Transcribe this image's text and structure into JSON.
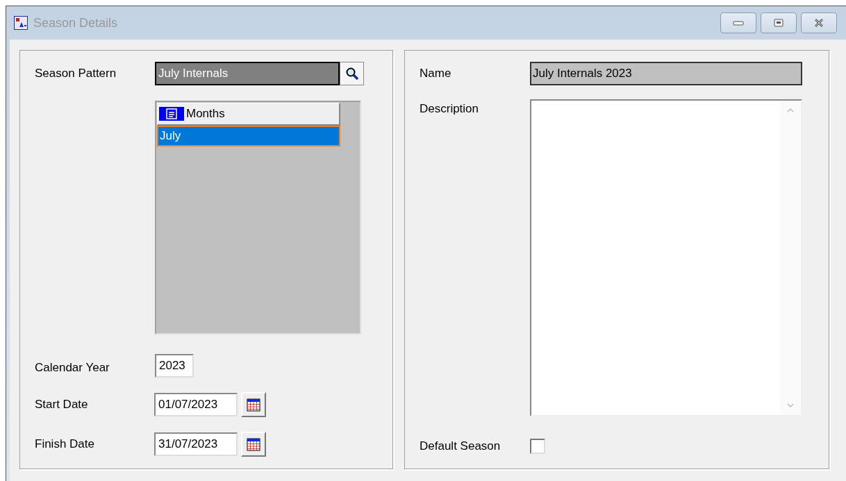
{
  "window": {
    "title": "Season Details"
  },
  "season_pattern": {
    "label": "Season Pattern",
    "value": "July Internals"
  },
  "months_list": {
    "column": "Months",
    "rows": [
      {
        "label": "July",
        "selected": true
      }
    ]
  },
  "calendar_year": {
    "label": "Calendar Year",
    "value": "2023"
  },
  "start_date": {
    "label": "Start Date",
    "value": "01/07/2023"
  },
  "finish_date": {
    "label": "Finish Date",
    "value": "31/07/2023"
  },
  "name": {
    "label": "Name",
    "value": "July Internals 2023"
  },
  "description": {
    "label": "Description"
  },
  "default_season": {
    "label": "Default Season",
    "checked": false
  }
}
